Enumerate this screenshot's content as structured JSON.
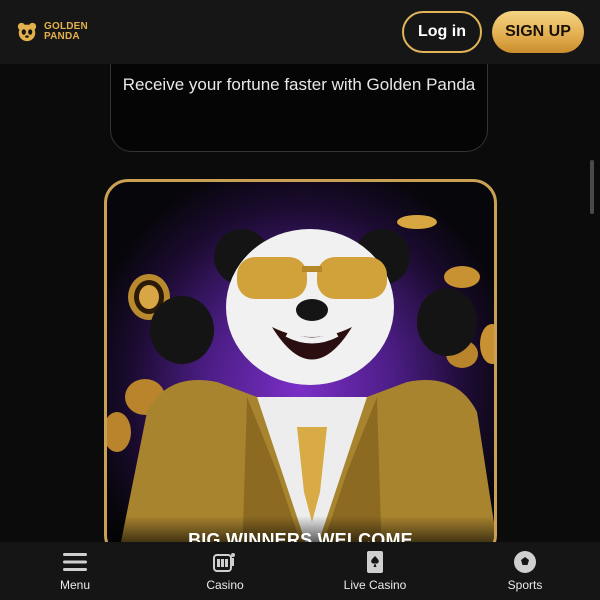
{
  "brand": {
    "line1": "GOLDEN",
    "line2": "PANDA"
  },
  "header": {
    "login_label": "Log in",
    "signup_label": "SIGN UP"
  },
  "fortune": {
    "text": "Receive your fortune faster with Golden Panda"
  },
  "promo": {
    "title": "BIG WINNERS WELCOME"
  },
  "bottom_nav": {
    "items": [
      {
        "label": "Menu",
        "icon": "menu-icon"
      },
      {
        "label": "Casino",
        "icon": "casino-icon"
      },
      {
        "label": "Live Casino",
        "icon": "live-casino-icon"
      },
      {
        "label": "Sports",
        "icon": "sports-icon"
      }
    ]
  },
  "colors": {
    "gold": "#e1b457",
    "background": "#0b0b0c",
    "promo_purple": "#7b2fc8"
  }
}
